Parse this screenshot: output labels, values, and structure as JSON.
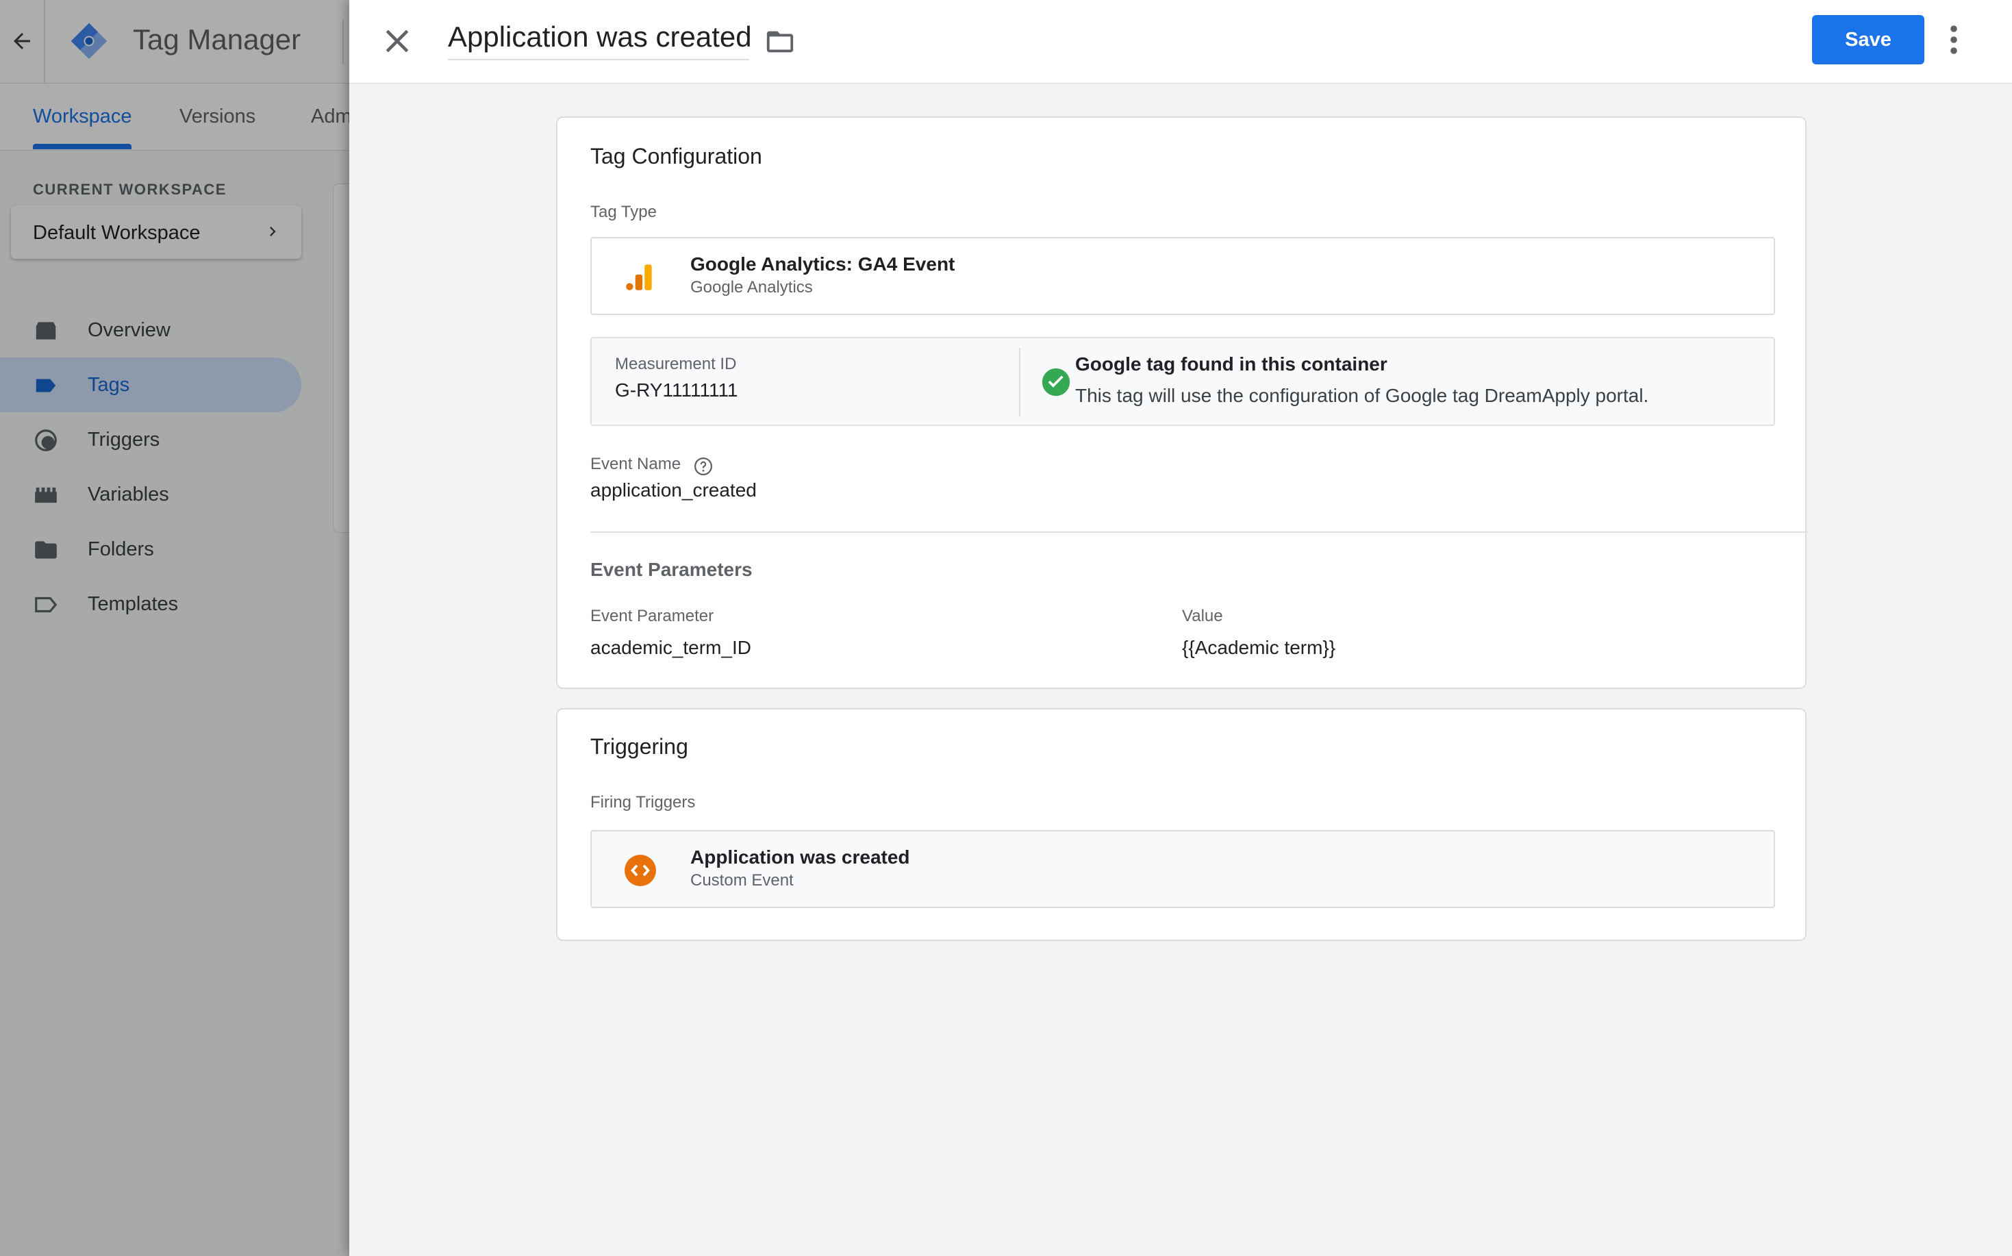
{
  "app": {
    "title": "Tag Manager",
    "tabs": [
      {
        "label": "Workspace"
      },
      {
        "label": "Versions"
      },
      {
        "label": "Adm"
      }
    ],
    "current_workspace_label": "CURRENT WORKSPACE",
    "current_workspace": "Default Workspace",
    "sidebar": [
      {
        "label": "Overview",
        "icon": "overview-icon"
      },
      {
        "label": "Tags",
        "icon": "tag-icon",
        "active": true
      },
      {
        "label": "Triggers",
        "icon": "trigger-icon"
      },
      {
        "label": "Variables",
        "icon": "variables-icon"
      },
      {
        "label": "Folders",
        "icon": "folder-icon"
      },
      {
        "label": "Templates",
        "icon": "template-icon"
      }
    ]
  },
  "panel": {
    "tag_name": "Application was created",
    "save_label": "Save",
    "config": {
      "title": "Tag Configuration",
      "tag_type_label": "Tag Type",
      "tag_type_name": "Google Analytics: GA4 Event",
      "tag_type_vendor": "Google Analytics",
      "measurement_id_label": "Measurement ID",
      "measurement_id": "G-RY11111111",
      "google_tag_status_title": "Google tag found in this container",
      "google_tag_status_desc": "This tag will use the configuration of Google tag DreamApply portal.",
      "event_name_label": "Event Name",
      "event_name": "application_created",
      "event_params_title": "Event Parameters",
      "param_col_label": "Event Parameter",
      "value_col_label": "Value",
      "params": [
        {
          "name": "academic_term_ID",
          "value": "{{Academic term}}"
        }
      ]
    },
    "triggering": {
      "title": "Triggering",
      "firing_label": "Firing Triggers",
      "trigger_name": "Application was created",
      "trigger_type": "Custom Event"
    }
  },
  "colors": {
    "accent": "#1a73e8",
    "ga_orange": "#f9ab00",
    "trigger_orange": "#e8710a",
    "success_green": "#34a853"
  }
}
